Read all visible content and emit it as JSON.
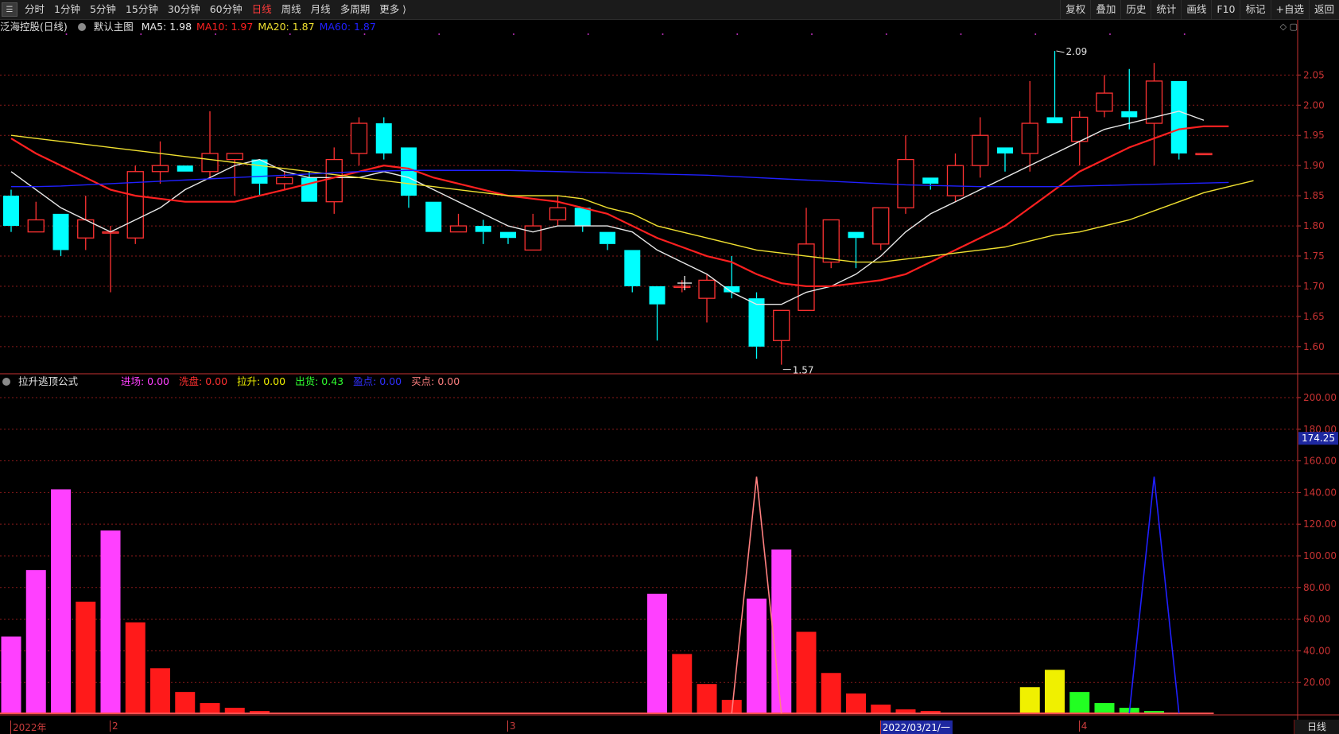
{
  "toolbar": {
    "items": [
      "分时",
      "1分钟",
      "5分钟",
      "15分钟",
      "30分钟",
      "60分钟",
      "日线",
      "周线",
      "月线",
      "多周期",
      "更多 ⟩"
    ],
    "active": "日线",
    "right_items": [
      "复权",
      "叠加",
      "历史",
      "统计",
      "画线",
      "F10",
      "标记",
      "+自选",
      "返回"
    ]
  },
  "price_panel": {
    "title": "泛海控股(日线)",
    "template": "默认主图",
    "ma_labels": [
      {
        "text": "MA5: 1.98",
        "color": "#e8e8e8"
      },
      {
        "text": "MA10: 1.97",
        "color": "#ff2020"
      },
      {
        "text": "MA20: 1.87",
        "color": "#f0e030"
      },
      {
        "text": "MA60: 1.87",
        "color": "#2020ff"
      }
    ],
    "y_ticks": [
      "2.05",
      "2.00",
      "1.95",
      "1.90",
      "1.85",
      "1.80",
      "1.75",
      "1.70",
      "1.65",
      "1.60"
    ],
    "high_annotation": "2.09",
    "low_annotation": "1.57"
  },
  "indicator_panel": {
    "title": "拉升逃顶公式",
    "labels": [
      {
        "text": "进场: 0.00",
        "color": "#ff40ff"
      },
      {
        "text": "洗盘: 0.00",
        "color": "#ff3030"
      },
      {
        "text": "拉升: 0.00",
        "color": "#f0f000"
      },
      {
        "text": "出货: 0.43",
        "color": "#30ff30"
      },
      {
        "text": "盈点: 0.00",
        "color": "#3030ff"
      },
      {
        "text": "买点: 0.00",
        "color": "#ff8080"
      }
    ],
    "y_ticks": [
      "200.00",
      "180.00",
      "160.00",
      "140.00",
      "120.00",
      "100.00",
      "80.00",
      "60.00",
      "40.00",
      "20.00"
    ],
    "current_value": "174.25"
  },
  "x_axis": {
    "labels": [
      {
        "text": "2022年",
        "index": 0
      },
      {
        "text": "2",
        "index": 4
      },
      {
        "text": "3",
        "index": 20
      },
      {
        "text": "2022/03/21/一",
        "index": 35,
        "highlight": true
      },
      {
        "text": "4",
        "index": 43
      }
    ]
  },
  "footer": {
    "period": "日线"
  },
  "colors": {
    "up": "#ff3232",
    "down": "#00ffff",
    "grid": "#8a1a1a",
    "axis": "#c83232"
  },
  "chart_data": [
    {
      "type": "candlestick",
      "title": "泛海控股(日线)",
      "ylim": [
        1.555,
        2.115
      ],
      "candles": [
        {
          "o": 1.85,
          "h": 1.86,
          "l": 1.79,
          "c": 1.8
        },
        {
          "o": 1.79,
          "h": 1.84,
          "l": 1.79,
          "c": 1.81
        },
        {
          "o": 1.82,
          "h": 1.82,
          "l": 1.75,
          "c": 1.76
        },
        {
          "o": 1.78,
          "h": 1.85,
          "l": 1.76,
          "c": 1.81
        },
        {
          "o": 1.79,
          "h": 1.8,
          "l": 1.69,
          "c": 1.79
        },
        {
          "o": 1.78,
          "h": 1.9,
          "l": 1.77,
          "c": 1.89
        },
        {
          "o": 1.89,
          "h": 1.94,
          "l": 1.87,
          "c": 1.9
        },
        {
          "o": 1.9,
          "h": 1.9,
          "l": 1.89,
          "c": 1.89
        },
        {
          "o": 1.89,
          "h": 1.99,
          "l": 1.88,
          "c": 1.92
        },
        {
          "o": 1.91,
          "h": 1.92,
          "l": 1.85,
          "c": 1.92
        },
        {
          "o": 1.91,
          "h": 1.91,
          "l": 1.85,
          "c": 1.87
        },
        {
          "o": 1.87,
          "h": 1.89,
          "l": 1.86,
          "c": 1.88
        },
        {
          "o": 1.88,
          "h": 1.89,
          "l": 1.84,
          "c": 1.84
        },
        {
          "o": 1.84,
          "h": 1.93,
          "l": 1.82,
          "c": 1.91
        },
        {
          "o": 1.92,
          "h": 1.98,
          "l": 1.9,
          "c": 1.97
        },
        {
          "o": 1.97,
          "h": 1.98,
          "l": 1.91,
          "c": 1.92
        },
        {
          "o": 1.93,
          "h": 1.93,
          "l": 1.83,
          "c": 1.85
        },
        {
          "o": 1.84,
          "h": 1.84,
          "l": 1.79,
          "c": 1.79
        },
        {
          "o": 1.79,
          "h": 1.82,
          "l": 1.79,
          "c": 1.8
        },
        {
          "o": 1.8,
          "h": 1.81,
          "l": 1.77,
          "c": 1.79
        },
        {
          "o": 1.79,
          "h": 1.79,
          "l": 1.77,
          "c": 1.78
        },
        {
          "o": 1.76,
          "h": 1.82,
          "l": 1.76,
          "c": 1.8
        },
        {
          "o": 1.81,
          "h": 1.85,
          "l": 1.8,
          "c": 1.83
        },
        {
          "o": 1.83,
          "h": 1.83,
          "l": 1.79,
          "c": 1.8
        },
        {
          "o": 1.79,
          "h": 1.79,
          "l": 1.76,
          "c": 1.77
        },
        {
          "o": 1.76,
          "h": 1.76,
          "l": 1.69,
          "c": 1.7
        },
        {
          "o": 1.7,
          "h": 1.7,
          "l": 1.61,
          "c": 1.67
        },
        {
          "o": 1.7,
          "h": 1.71,
          "l": 1.69,
          "c": 1.7
        },
        {
          "o": 1.68,
          "h": 1.72,
          "l": 1.64,
          "c": 1.71
        },
        {
          "o": 1.7,
          "h": 1.75,
          "l": 1.68,
          "c": 1.69
        },
        {
          "o": 1.68,
          "h": 1.69,
          "l": 1.58,
          "c": 1.6
        },
        {
          "o": 1.61,
          "h": 1.66,
          "l": 1.57,
          "c": 1.66
        },
        {
          "o": 1.66,
          "h": 1.83,
          "l": 1.66,
          "c": 1.77
        },
        {
          "o": 1.74,
          "h": 1.81,
          "l": 1.73,
          "c": 1.81
        },
        {
          "o": 1.79,
          "h": 1.79,
          "l": 1.73,
          "c": 1.78
        },
        {
          "o": 1.77,
          "h": 1.83,
          "l": 1.76,
          "c": 1.83
        },
        {
          "o": 1.83,
          "h": 1.95,
          "l": 1.82,
          "c": 1.91
        },
        {
          "o": 1.88,
          "h": 1.88,
          "l": 1.86,
          "c": 1.87
        },
        {
          "o": 1.85,
          "h": 1.92,
          "l": 1.84,
          "c": 1.9
        },
        {
          "o": 1.9,
          "h": 1.98,
          "l": 1.88,
          "c": 1.95
        },
        {
          "o": 1.93,
          "h": 1.93,
          "l": 1.89,
          "c": 1.92
        },
        {
          "o": 1.92,
          "h": 2.04,
          "l": 1.89,
          "c": 1.97
        },
        {
          "o": 1.98,
          "h": 2.09,
          "l": 1.97,
          "c": 1.97
        },
        {
          "o": 1.94,
          "h": 1.99,
          "l": 1.9,
          "c": 1.98
        },
        {
          "o": 1.99,
          "h": 2.05,
          "l": 1.98,
          "c": 2.02
        },
        {
          "o": 1.99,
          "h": 2.06,
          "l": 1.96,
          "c": 1.98
        },
        {
          "o": 1.97,
          "h": 2.07,
          "l": 1.9,
          "c": 2.04
        },
        {
          "o": 2.04,
          "h": 2.04,
          "l": 1.91,
          "c": 1.92
        },
        {
          "o": 1.92,
          "h": 1.92,
          "l": 1.92,
          "c": 1.92
        }
      ],
      "ma": [
        {
          "name": "MA5",
          "color": "#e8e8e8",
          "values": [
            1.89,
            1.86,
            1.83,
            1.81,
            1.79,
            1.81,
            1.83,
            1.86,
            1.88,
            1.9,
            1.91,
            1.89,
            1.88,
            1.88,
            1.88,
            1.89,
            1.88,
            1.86,
            1.84,
            1.82,
            1.8,
            1.79,
            1.8,
            1.8,
            1.8,
            1.79,
            1.76,
            1.74,
            1.72,
            1.69,
            1.67,
            1.67,
            1.69,
            1.7,
            1.72,
            1.75,
            1.79,
            1.82,
            1.84,
            1.86,
            1.88,
            1.9,
            1.92,
            1.94,
            1.96,
            1.97,
            1.98,
            1.99,
            1.975
          ]
        },
        {
          "name": "MA10",
          "color": "#ff2020",
          "values": [
            1.945,
            1.92,
            1.9,
            1.88,
            1.86,
            1.85,
            1.845,
            1.84,
            1.84,
            1.84,
            1.85,
            1.86,
            1.87,
            1.88,
            1.89,
            1.9,
            1.895,
            1.88,
            1.87,
            1.86,
            1.85,
            1.845,
            1.84,
            1.83,
            1.82,
            1.8,
            1.78,
            1.765,
            1.75,
            1.74,
            1.72,
            1.705,
            1.7,
            1.7,
            1.705,
            1.71,
            1.72,
            1.74,
            1.76,
            1.78,
            1.8,
            1.83,
            1.86,
            1.89,
            1.91,
            1.93,
            1.945,
            1.96,
            1.965,
            1.965
          ]
        },
        {
          "name": "MA20",
          "color": "#f0e030",
          "values": [
            1.95,
            1.945,
            1.94,
            1.935,
            1.93,
            1.925,
            1.92,
            1.915,
            1.91,
            1.905,
            1.9,
            1.895,
            1.89,
            1.885,
            1.88,
            1.875,
            1.87,
            1.865,
            1.86,
            1.855,
            1.85,
            1.85,
            1.85,
            1.845,
            1.83,
            1.82,
            1.8,
            1.79,
            1.78,
            1.77,
            1.76,
            1.755,
            1.75,
            1.745,
            1.74,
            1.74,
            1.745,
            1.75,
            1.755,
            1.76,
            1.765,
            1.775,
            1.785,
            1.79,
            1.8,
            1.81,
            1.825,
            1.84,
            1.855,
            1.865,
            1.875
          ]
        },
        {
          "name": "MA60",
          "color": "#2020ff",
          "values": [
            1.865,
            1.865,
            1.866,
            1.868,
            1.87,
            1.872,
            1.874,
            1.876,
            1.878,
            1.88,
            1.882,
            1.884,
            1.886,
            1.888,
            1.89,
            1.891,
            1.892,
            1.892,
            1.892,
            1.892,
            1.892,
            1.891,
            1.89,
            1.889,
            1.888,
            1.887,
            1.886,
            1.885,
            1.884,
            1.882,
            1.88,
            1.878,
            1.876,
            1.874,
            1.872,
            1.87,
            1.868,
            1.867,
            1.866,
            1.865,
            1.865,
            1.865,
            1.865,
            1.866,
            1.867,
            1.868,
            1.869,
            1.87,
            1.871,
            1.872
          ]
        }
      ]
    },
    {
      "type": "bar",
      "title": "拉升逃顶公式",
      "ylim": [
        0,
        205
      ],
      "bars": [
        {
          "v": 49,
          "c": "#ff40ff"
        },
        {
          "v": 91,
          "c": "#ff40ff"
        },
        {
          "v": 142,
          "c": "#ff40ff"
        },
        {
          "v": 71,
          "c": "#ff1a1a"
        },
        {
          "v": 116,
          "c": "#ff40ff"
        },
        {
          "v": 58,
          "c": "#ff1a1a"
        },
        {
          "v": 29,
          "c": "#ff1a1a"
        },
        {
          "v": 14,
          "c": "#ff1a1a"
        },
        {
          "v": 7,
          "c": "#ff1a1a"
        },
        {
          "v": 4,
          "c": "#ff1a1a"
        },
        {
          "v": 2,
          "c": "#ff1a1a"
        },
        {
          "v": 1,
          "c": "#ff1a1a"
        },
        {
          "v": 0,
          "c": "#ff1a1a"
        },
        {
          "v": 0,
          "c": "#ff1a1a"
        },
        {
          "v": 0,
          "c": "#ff1a1a"
        },
        {
          "v": 0,
          "c": "#ff1a1a"
        },
        {
          "v": 0,
          "c": "#ff1a1a"
        },
        {
          "v": 0,
          "c": "#ff1a1a"
        },
        {
          "v": 0,
          "c": "#ff1a1a"
        },
        {
          "v": 0,
          "c": "#ff1a1a"
        },
        {
          "v": 0,
          "c": "#ff1a1a"
        },
        {
          "v": 0,
          "c": "#ff1a1a"
        },
        {
          "v": 0,
          "c": "#ff1a1a"
        },
        {
          "v": 0,
          "c": "#ff1a1a"
        },
        {
          "v": 0,
          "c": "#ff1a1a"
        },
        {
          "v": 0,
          "c": "#ff1a1a"
        },
        {
          "v": 76,
          "c": "#ff40ff"
        },
        {
          "v": 38,
          "c": "#ff1a1a"
        },
        {
          "v": 19,
          "c": "#ff1a1a"
        },
        {
          "v": 9,
          "c": "#ff1a1a"
        },
        {
          "v": 73,
          "c": "#ff40ff"
        },
        {
          "v": 104,
          "c": "#ff40ff"
        },
        {
          "v": 52,
          "c": "#ff1a1a"
        },
        {
          "v": 26,
          "c": "#ff1a1a"
        },
        {
          "v": 13,
          "c": "#ff1a1a"
        },
        {
          "v": 6,
          "c": "#ff1a1a"
        },
        {
          "v": 3,
          "c": "#ff1a1a"
        },
        {
          "v": 2,
          "c": "#ff1a1a"
        },
        {
          "v": 1,
          "c": "#ff1a1a"
        },
        {
          "v": 0,
          "c": "#ff1a1a"
        },
        {
          "v": 0,
          "c": "#ff1a1a"
        },
        {
          "v": 17,
          "c": "#f0f000"
        },
        {
          "v": 28,
          "c": "#f0f000"
        },
        {
          "v": 14,
          "c": "#22ff22"
        },
        {
          "v": 7,
          "c": "#22ff22"
        },
        {
          "v": 4,
          "c": "#22ff22"
        },
        {
          "v": 2,
          "c": "#22ff22"
        },
        {
          "v": 1,
          "c": "#22ff22"
        },
        {
          "v": 0.43,
          "c": "#22ff22"
        }
      ],
      "spikes": [
        {
          "color": "#ff8080",
          "from": 29,
          "peak": 30,
          "to": 31,
          "value": 150
        },
        {
          "color": "#2020ff",
          "from": 45,
          "peak": 46,
          "to": 47,
          "value": 150
        }
      ]
    }
  ]
}
